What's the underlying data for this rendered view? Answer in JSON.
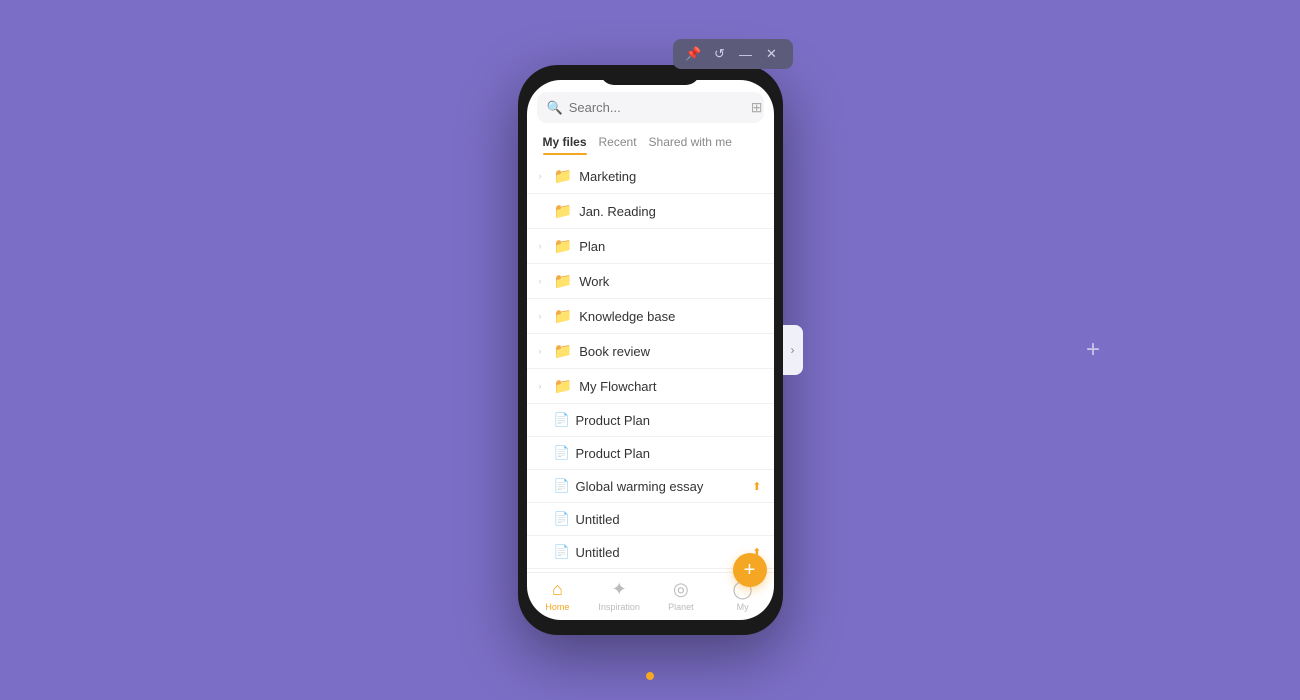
{
  "background": {
    "color": "#7b6ec6"
  },
  "window_controls": {
    "pin_label": "📌",
    "history_label": "↺",
    "minimize_label": "—",
    "close_label": "✕"
  },
  "search": {
    "placeholder": "Search..."
  },
  "tabs": [
    {
      "id": "my-files",
      "label": "My files",
      "active": true
    },
    {
      "id": "recent",
      "label": "Recent",
      "active": false
    },
    {
      "id": "shared",
      "label": "Shared with me",
      "active": false
    }
  ],
  "file_list": [
    {
      "type": "folder",
      "name": "Marketing",
      "has_chevron": true
    },
    {
      "type": "folder",
      "name": "Jan. Reading",
      "has_chevron": false
    },
    {
      "type": "folder",
      "name": "Plan",
      "has_chevron": true
    },
    {
      "type": "folder",
      "name": "Work",
      "has_chevron": true
    },
    {
      "type": "folder",
      "name": "Knowledge base",
      "has_chevron": true
    },
    {
      "type": "folder",
      "name": "Book review",
      "has_chevron": true
    },
    {
      "type": "folder",
      "name": "My Flowchart",
      "has_chevron": true
    },
    {
      "type": "doc",
      "name": "Product Plan",
      "has_chevron": false,
      "shared": false
    },
    {
      "type": "doc",
      "name": "Product Plan",
      "has_chevron": false,
      "shared": false
    },
    {
      "type": "doc",
      "name": "Global warming essay",
      "has_chevron": false,
      "shared": true
    },
    {
      "type": "doc",
      "name": "Untitled",
      "has_chevron": false,
      "shared": false,
      "blue": true
    },
    {
      "type": "doc",
      "name": "Untitled",
      "has_chevron": false,
      "shared": true,
      "blue": false
    }
  ],
  "fab": {
    "label": "+"
  },
  "bottom_nav": [
    {
      "id": "home",
      "label": "Home",
      "icon": "⌂",
      "active": true
    },
    {
      "id": "inspiration",
      "label": "Inspiration",
      "icon": "✦",
      "active": false
    },
    {
      "id": "planet",
      "label": "Planet",
      "icon": "◎",
      "active": false
    },
    {
      "id": "my",
      "label": "My",
      "icon": "◯",
      "active": false
    }
  ],
  "right_tab": {
    "icon": "›"
  },
  "plus_icon": "+",
  "orange_dot": true
}
